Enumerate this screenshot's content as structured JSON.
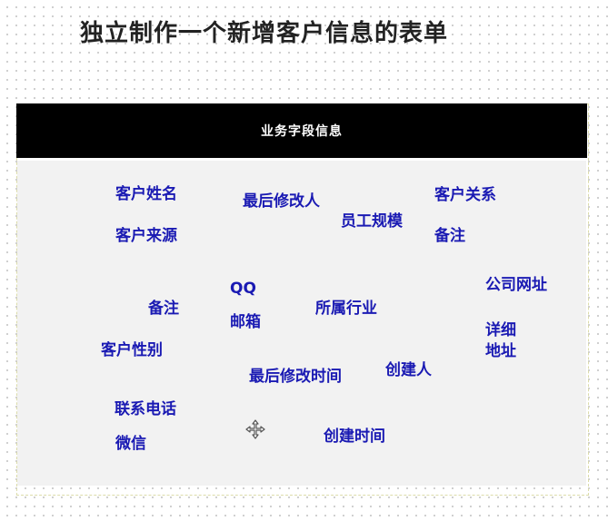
{
  "page_title": "独立制作一个新增客户信息的表单",
  "panel": {
    "header_label": "业务字段信息"
  },
  "fields": {
    "customer_name": "客户姓名",
    "last_modifier": "最后修改人",
    "customer_relation": "客户关系",
    "employee_size": "员工规模",
    "customer_source": "客户来源",
    "remark_right": "备注",
    "qq": "QQ",
    "company_website": "公司网址",
    "remark_left": "备注",
    "industry": "所属行业",
    "email": "邮箱",
    "detailed_address": "详细地址",
    "customer_gender": "客户性别",
    "creator": "创建人",
    "last_modified_time": "最后修改时间",
    "contact_phone": "联系电话",
    "wechat": "微信",
    "created_time": "创建时间"
  },
  "icons": {
    "move_cursor": "move-cursor-icon"
  }
}
